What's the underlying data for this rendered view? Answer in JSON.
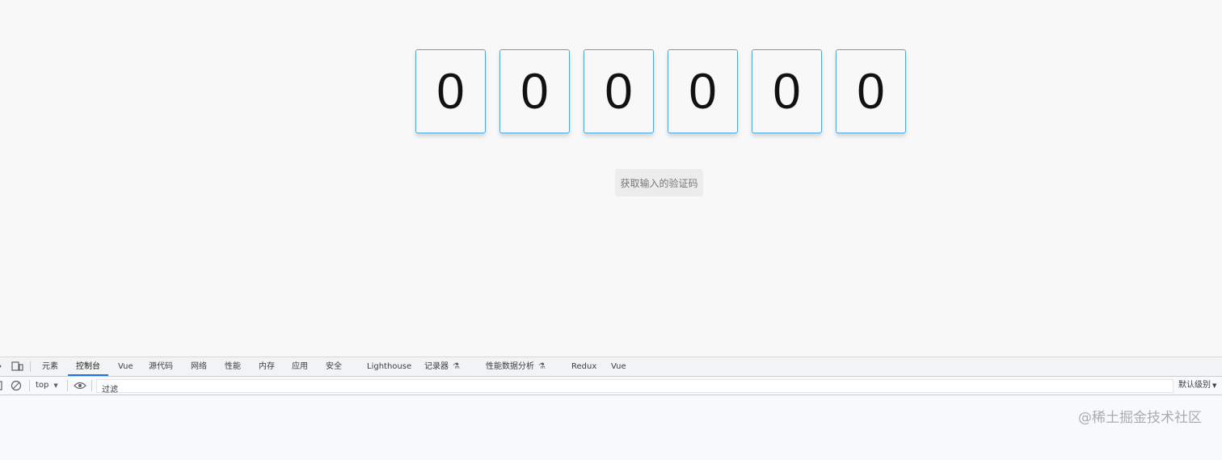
{
  "code_inputs": {
    "digits": [
      "0",
      "0",
      "0",
      "0",
      "0",
      "0"
    ]
  },
  "get_code_button": {
    "label": "获取输入的验证码"
  },
  "devtools": {
    "tabs": [
      "元素",
      "控制台",
      "Vue",
      "源代码",
      "网络",
      "性能",
      "内存",
      "应用",
      "安全",
      "Lighthouse",
      "记录器",
      "性能数据分析",
      "Redux",
      "Vue"
    ],
    "active_tab": "控制台",
    "icons": {
      "inspect": "inspect-element-icon",
      "device": "device-toolbar-icon",
      "sidebar": "sidebar-toggle-icon",
      "clear": "clear-console-icon",
      "eye": "live-expression-icon",
      "flask": "experimental-flask-icon"
    },
    "context": "top",
    "filter_placeholder": "过滤",
    "levels": "默认级别"
  },
  "watermark": "@稀土掘金技术社区"
}
